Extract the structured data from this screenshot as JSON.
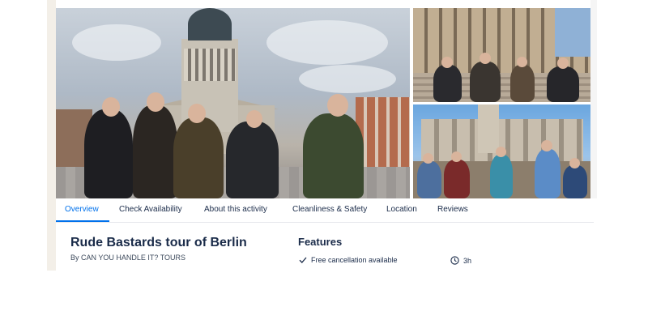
{
  "gallery": {
    "main_photo": "berlin-gendarmenmarkt-group-photo",
    "top_right_photo": "group-in-front-of-concert-hall",
    "bottom_right_photo": "group-at-soviet-war-memorial"
  },
  "tabs": [
    {
      "label": "Overview",
      "active": true
    },
    {
      "label": "Check Availability",
      "active": false
    },
    {
      "label": "About this activity",
      "active": false
    },
    {
      "label": "Cleanliness & Safety",
      "active": false
    },
    {
      "label": "Location",
      "active": false
    },
    {
      "label": "Reviews",
      "active": false
    }
  ],
  "tour": {
    "title": "Rude Bastards tour of Berlin",
    "operator": "By CAN YOU HANDLE IT? TOURS"
  },
  "features": {
    "heading": "Features",
    "items": [
      {
        "icon": "checkmark-icon",
        "label": "Free cancellation available"
      },
      {
        "icon": "clock-icon",
        "label": "3h"
      }
    ]
  },
  "colors": {
    "accent": "#0071eb",
    "text": "#1a2b49"
  }
}
